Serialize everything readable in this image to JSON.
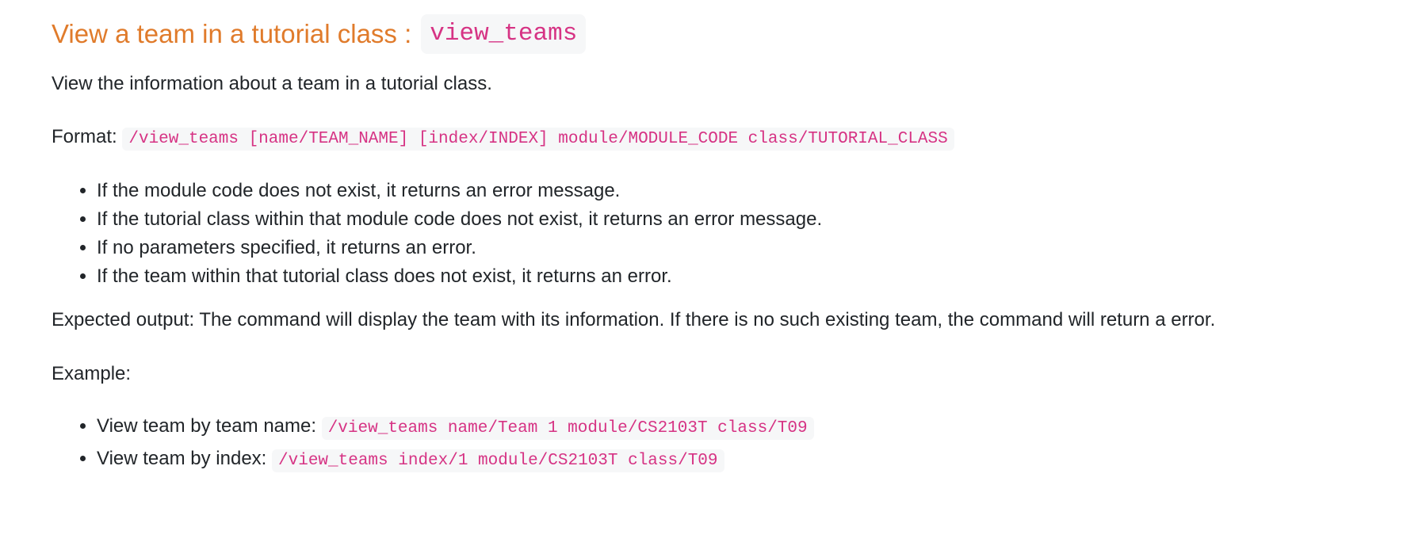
{
  "heading": {
    "text": "View a team in a tutorial class :",
    "code": "view_teams"
  },
  "description": "View the information about a team in a tutorial class.",
  "format": {
    "label": "Format:",
    "code": "/view_teams [name/TEAM_NAME] [index/INDEX] module/MODULE_CODE class/TUTORIAL_CLASS"
  },
  "conditions": [
    "If the module code does not exist, it returns an error message.",
    "If the tutorial class within that module code does not exist, it returns an error message.",
    "If no parameters specified, it returns an error.",
    "If the team within that tutorial class does not exist, it returns an error."
  ],
  "expected_output": "Expected output: The command will display the team with its information. If there is no such existing team, the command will return a error.",
  "example_label": "Example:",
  "examples": [
    {
      "text": "View team by team name:",
      "code": "/view_teams name/Team 1 module/CS2103T class/T09"
    },
    {
      "text": "View team by index:",
      "code": "/view_teams index/1 module/CS2103T class/T09"
    }
  ],
  "colors": {
    "heading": "#e07b2b",
    "code_text": "#d63384",
    "code_background": "#f6f7f8",
    "body_text": "#212529"
  }
}
